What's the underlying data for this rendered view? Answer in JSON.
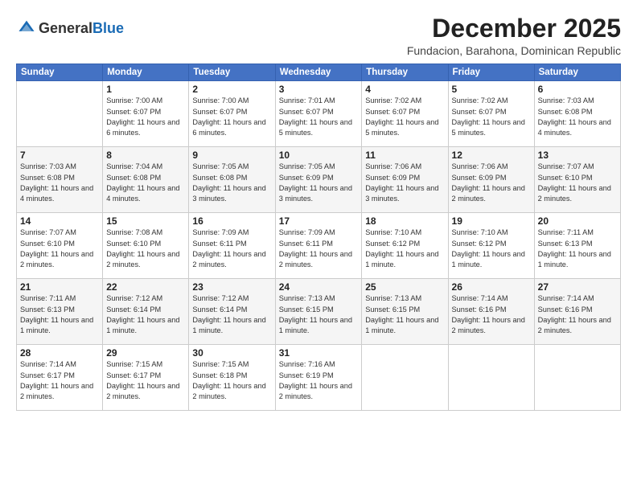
{
  "logo": {
    "general": "General",
    "blue": "Blue"
  },
  "header": {
    "month": "December 2025",
    "location": "Fundacion, Barahona, Dominican Republic"
  },
  "weekdays": [
    "Sunday",
    "Monday",
    "Tuesday",
    "Wednesday",
    "Thursday",
    "Friday",
    "Saturday"
  ],
  "weeks": [
    [
      {
        "day": "",
        "sunrise": "",
        "sunset": "",
        "daylight": ""
      },
      {
        "day": "1",
        "sunrise": "Sunrise: 7:00 AM",
        "sunset": "Sunset: 6:07 PM",
        "daylight": "Daylight: 11 hours and 6 minutes."
      },
      {
        "day": "2",
        "sunrise": "Sunrise: 7:00 AM",
        "sunset": "Sunset: 6:07 PM",
        "daylight": "Daylight: 11 hours and 6 minutes."
      },
      {
        "day": "3",
        "sunrise": "Sunrise: 7:01 AM",
        "sunset": "Sunset: 6:07 PM",
        "daylight": "Daylight: 11 hours and 5 minutes."
      },
      {
        "day": "4",
        "sunrise": "Sunrise: 7:02 AM",
        "sunset": "Sunset: 6:07 PM",
        "daylight": "Daylight: 11 hours and 5 minutes."
      },
      {
        "day": "5",
        "sunrise": "Sunrise: 7:02 AM",
        "sunset": "Sunset: 6:07 PM",
        "daylight": "Daylight: 11 hours and 5 minutes."
      },
      {
        "day": "6",
        "sunrise": "Sunrise: 7:03 AM",
        "sunset": "Sunset: 6:08 PM",
        "daylight": "Daylight: 11 hours and 4 minutes."
      }
    ],
    [
      {
        "day": "7",
        "sunrise": "Sunrise: 7:03 AM",
        "sunset": "Sunset: 6:08 PM",
        "daylight": "Daylight: 11 hours and 4 minutes."
      },
      {
        "day": "8",
        "sunrise": "Sunrise: 7:04 AM",
        "sunset": "Sunset: 6:08 PM",
        "daylight": "Daylight: 11 hours and 4 minutes."
      },
      {
        "day": "9",
        "sunrise": "Sunrise: 7:05 AM",
        "sunset": "Sunset: 6:08 PM",
        "daylight": "Daylight: 11 hours and 3 minutes."
      },
      {
        "day": "10",
        "sunrise": "Sunrise: 7:05 AM",
        "sunset": "Sunset: 6:09 PM",
        "daylight": "Daylight: 11 hours and 3 minutes."
      },
      {
        "day": "11",
        "sunrise": "Sunrise: 7:06 AM",
        "sunset": "Sunset: 6:09 PM",
        "daylight": "Daylight: 11 hours and 3 minutes."
      },
      {
        "day": "12",
        "sunrise": "Sunrise: 7:06 AM",
        "sunset": "Sunset: 6:09 PM",
        "daylight": "Daylight: 11 hours and 2 minutes."
      },
      {
        "day": "13",
        "sunrise": "Sunrise: 7:07 AM",
        "sunset": "Sunset: 6:10 PM",
        "daylight": "Daylight: 11 hours and 2 minutes."
      }
    ],
    [
      {
        "day": "14",
        "sunrise": "Sunrise: 7:07 AM",
        "sunset": "Sunset: 6:10 PM",
        "daylight": "Daylight: 11 hours and 2 minutes."
      },
      {
        "day": "15",
        "sunrise": "Sunrise: 7:08 AM",
        "sunset": "Sunset: 6:10 PM",
        "daylight": "Daylight: 11 hours and 2 minutes."
      },
      {
        "day": "16",
        "sunrise": "Sunrise: 7:09 AM",
        "sunset": "Sunset: 6:11 PM",
        "daylight": "Daylight: 11 hours and 2 minutes."
      },
      {
        "day": "17",
        "sunrise": "Sunrise: 7:09 AM",
        "sunset": "Sunset: 6:11 PM",
        "daylight": "Daylight: 11 hours and 2 minutes."
      },
      {
        "day": "18",
        "sunrise": "Sunrise: 7:10 AM",
        "sunset": "Sunset: 6:12 PM",
        "daylight": "Daylight: 11 hours and 1 minute."
      },
      {
        "day": "19",
        "sunrise": "Sunrise: 7:10 AM",
        "sunset": "Sunset: 6:12 PM",
        "daylight": "Daylight: 11 hours and 1 minute."
      },
      {
        "day": "20",
        "sunrise": "Sunrise: 7:11 AM",
        "sunset": "Sunset: 6:13 PM",
        "daylight": "Daylight: 11 hours and 1 minute."
      }
    ],
    [
      {
        "day": "21",
        "sunrise": "Sunrise: 7:11 AM",
        "sunset": "Sunset: 6:13 PM",
        "daylight": "Daylight: 11 hours and 1 minute."
      },
      {
        "day": "22",
        "sunrise": "Sunrise: 7:12 AM",
        "sunset": "Sunset: 6:14 PM",
        "daylight": "Daylight: 11 hours and 1 minute."
      },
      {
        "day": "23",
        "sunrise": "Sunrise: 7:12 AM",
        "sunset": "Sunset: 6:14 PM",
        "daylight": "Daylight: 11 hours and 1 minute."
      },
      {
        "day": "24",
        "sunrise": "Sunrise: 7:13 AM",
        "sunset": "Sunset: 6:15 PM",
        "daylight": "Daylight: 11 hours and 1 minute."
      },
      {
        "day": "25",
        "sunrise": "Sunrise: 7:13 AM",
        "sunset": "Sunset: 6:15 PM",
        "daylight": "Daylight: 11 hours and 1 minute."
      },
      {
        "day": "26",
        "sunrise": "Sunrise: 7:14 AM",
        "sunset": "Sunset: 6:16 PM",
        "daylight": "Daylight: 11 hours and 2 minutes."
      },
      {
        "day": "27",
        "sunrise": "Sunrise: 7:14 AM",
        "sunset": "Sunset: 6:16 PM",
        "daylight": "Daylight: 11 hours and 2 minutes."
      }
    ],
    [
      {
        "day": "28",
        "sunrise": "Sunrise: 7:14 AM",
        "sunset": "Sunset: 6:17 PM",
        "daylight": "Daylight: 11 hours and 2 minutes."
      },
      {
        "day": "29",
        "sunrise": "Sunrise: 7:15 AM",
        "sunset": "Sunset: 6:17 PM",
        "daylight": "Daylight: 11 hours and 2 minutes."
      },
      {
        "day": "30",
        "sunrise": "Sunrise: 7:15 AM",
        "sunset": "Sunset: 6:18 PM",
        "daylight": "Daylight: 11 hours and 2 minutes."
      },
      {
        "day": "31",
        "sunrise": "Sunrise: 7:16 AM",
        "sunset": "Sunset: 6:19 PM",
        "daylight": "Daylight: 11 hours and 2 minutes."
      },
      {
        "day": "",
        "sunrise": "",
        "sunset": "",
        "daylight": ""
      },
      {
        "day": "",
        "sunrise": "",
        "sunset": "",
        "daylight": ""
      },
      {
        "day": "",
        "sunrise": "",
        "sunset": "",
        "daylight": ""
      }
    ]
  ]
}
